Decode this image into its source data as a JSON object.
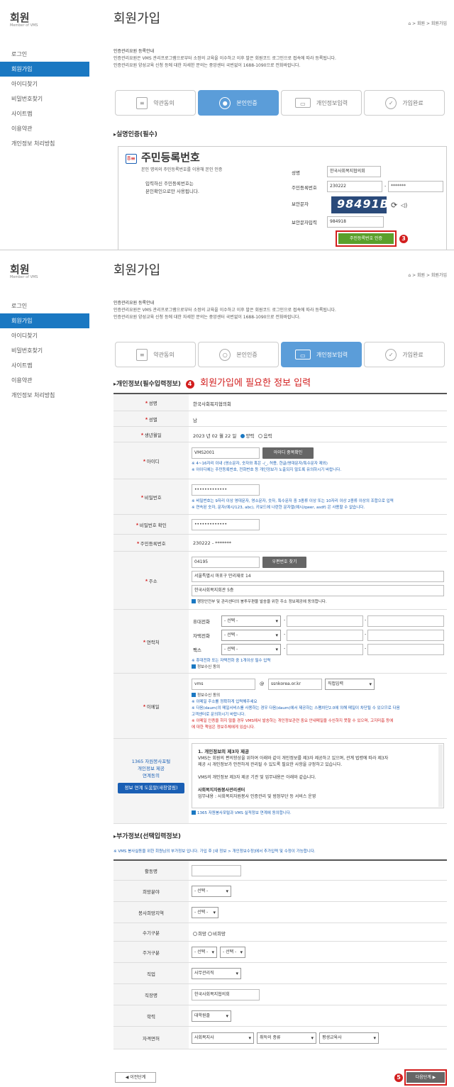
{
  "brand": {
    "title": "회원",
    "subtitle": "Member of VMS"
  },
  "menu": [
    "로그인",
    "회원가입",
    "아이디찾기",
    "비밀번호찾기",
    "사이트맵",
    "이용약관",
    "개인정보 처리방침"
  ],
  "menu2": [
    "로그인",
    "회원가입",
    "아이디찾기",
    "비밀번호찾기",
    "사이트맵",
    "이용약관",
    "개인정보 처리방침"
  ],
  "page": {
    "title": "회원가입",
    "breadcrumb": "⌂ > 회원 > 회원가입"
  },
  "intro": {
    "line1": "인증관리요원 등록안내",
    "line2": "인증관리요원은 VMS 관리프로그램으로부터 소정의 교육을 이수하고 이후 발은 회원코드 로그인으로 접속에 따라 등록됩니다.",
    "line3": "인증관리요원 양성교육 신청 등에 대한 자세한 문의는 중앙센터 국번없이 1688-1090으로 전화바랍니다."
  },
  "steps": [
    "약관동의",
    "본인인증",
    "개인정보입력",
    "가입완료"
  ],
  "auth": {
    "section": "실명인증(필수)",
    "heading": "주민등록번호",
    "desc": "본인 명의의 주민등록번호를 이용해 본인 인증",
    "note1": "입력하신 주민등록번호는",
    "note2": "본인확인으로만 사용됩니다.",
    "name_label": "성명",
    "name_value": "한국사회복지협의회",
    "rrn_label": "주민등록번호",
    "rrn_front": "230222",
    "rrn_back": "*******",
    "captcha_label": "보안문자",
    "captcha_text": "98491B",
    "captcha_input_label": "보안문자입력",
    "captcha_input": "984918",
    "button": "주민등록번호 인증",
    "marker": "3"
  },
  "personal": {
    "section": "개인정보(필수입력정보)",
    "marker": "4",
    "callout": "회원가입에 필요한 정보 입력",
    "name_label": "성명",
    "name": "한국사회복지협의회",
    "gender_label": "성별",
    "gender": "남",
    "birth_label": "생년월일",
    "birth": "2023 년   02 월   22 일",
    "solar": "양력",
    "lunar": "음력",
    "id_label": "아이디",
    "id": "VMS2001",
    "id_btn": "아이디 중복확인",
    "id_hint1": "※ 4~16자리 이내 (영소문자, 숫자와 혹은 -/_, 허용, 한글/영대문자/특수문자 제외)",
    "id_hint2": "※ 아이디에는 주민등록번호, 전화번호 등 개인정보가 노출되지 않도록 유의하시기 바랍니다.",
    "pw_label": "비밀번호",
    "pw": "•••••••••••••",
    "pw_hint1": "※ 비밀번호는 9자리 이상 영대문자, 영소문자, 숫자, 특수문자 중 3종류 이상 또는 10자리 이상 2종류 이상의 조합으로 입력",
    "pw_hint2": "※ 연속된 숫자, 문자(예시/123, abc), 키보드에 나란한 문자열(예시/qwer, asdf) 은 사용할 수 없습니다.",
    "pw2_label": "비밀번호 확인",
    "pw2": "•••••••••••••",
    "rrn_label": "주민등록번호",
    "rrn": "230222 - *******",
    "addr_label": "주소",
    "zip": "04195",
    "zip_btn": "우편번호 찾기",
    "addr1": "서울특별시 마포구 만리재로 14",
    "addr2": "한국사회복지회관 5층",
    "addr_chk": "행정안전부 및 관리센터의 봉투우편물 발송을 위한 주소 정보제공에 동의합니다.",
    "contact_label": "연락처",
    "mobile": "휴대전화",
    "home": "자택전화",
    "fax": "팩스",
    "select": "- 선택 -",
    "contact_hint": "※ 휴대전화 또는 자택전화 중 1개이상 필수 입력",
    "contact_chk": "정보수신 동의",
    "email_label": "이메일",
    "email_id": "vms",
    "email_domain": "ssnkorea.or.kr",
    "email_select": "직접입력",
    "email_chk": "정보수신 동의",
    "email_hint1": "※ 이메일 주소를 정확하게 입력해주세요",
    "email_hint2": "※ 다음(daum)의 메일서비스를 사용하는 경우 다음(daum)에서 제공하는 스팸차단2.0에 의해 메일이 차단될 수 있으므로 다음",
    "email_hint3": "고객센터로 문의하시기 바랍니다.",
    "email_hint4": "※ 이메일 인증을 하지 않을 경우 VMS에서 발송하는 개인정보관련 중요 안내메일을 수신하지 못할 수 있으며, 고지미흡 등에",
    "email_hint5": "에 대한 책임은 정보주체에게 있습니다.",
    "share_label1": "1365 자원봉사포털",
    "share_label2": "개인정보 제공",
    "share_label3": "연계동의",
    "share_btn": "정보 연계 도움말(새창열림)",
    "share_text": [
      "1. 개인정보의 제3자 제공",
      "VMS는 회원의 편의향상을 위하여 아래와 같이 개인정보를 제3자 제공하고 있으며, 관계 법령에 따라 제3자",
      "제공 시 개인정보가 안전하게 관리될 수 있도록 필요한 사항을 규정하고 있습니다.",
      "",
      "VMS의 개인정보 제3자 제공 기관 및 업무내용은 아래와 같습니다.",
      "",
      "사회복지자원봉사관리센터",
      "업무내용 : 사회복지자원봉사 인증관리 및 범정부단 등 서비스 운영"
    ],
    "share_chk": "1365 자원봉사포털과 VMS 실적정보 연계에 동의합니다."
  },
  "extra": {
    "section": "부가정보(선택입력정보)",
    "note": "※ VMS 봉사실동을 위한 회원님의 부가정보 입니다. 가입 후 [내 정보 > 개인정보수정]에서 추가입력 및 수정이 가능합니다.",
    "rows": [
      {
        "label": "활동명"
      },
      {
        "label": "희망분야",
        "value": "- 선택 -"
      },
      {
        "label": "봉사희망지역",
        "value": "- 선택 -"
      },
      {
        "label": "수기구분",
        "value": "희망",
        "value2": "비희망"
      },
      {
        "label": "주거구분",
        "value": "- 선택 -",
        "value2": "- 선택 -"
      },
      {
        "label": "직업",
        "value": "사무관리직"
      },
      {
        "label": "직장명",
        "value": "한국사회복지협의회"
      },
      {
        "label": "학력",
        "value": "대학원졸"
      },
      {
        "label": "자격면허",
        "value": "사회복지사",
        "value2": "취득의 종류",
        "value3": "평생교육사"
      }
    ],
    "prev_btn": "◀ 이전단계",
    "next_btn": "다음단계 ▶",
    "marker": "5"
  }
}
